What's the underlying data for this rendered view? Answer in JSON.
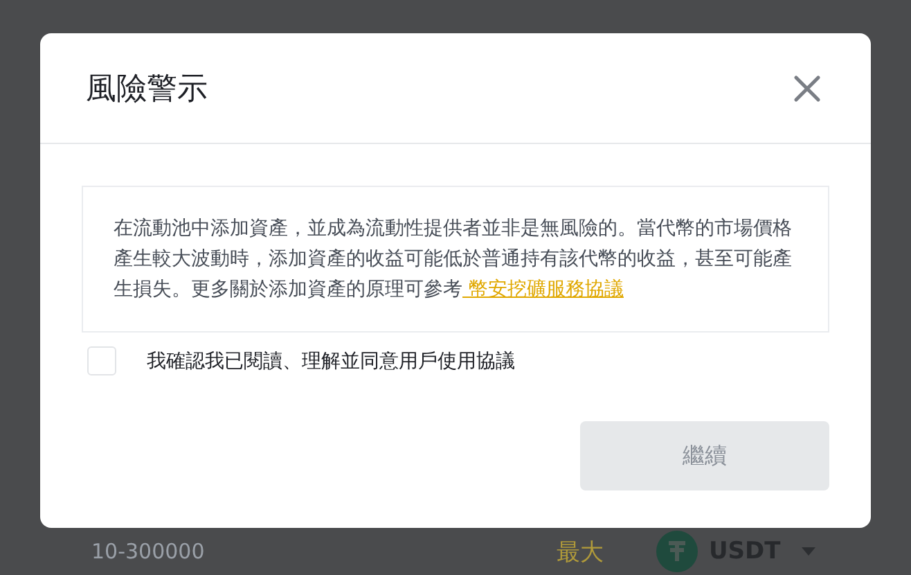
{
  "dialog": {
    "title": "風險警示",
    "notice": {
      "text": "在流動池中添加資產，並成為流動性提供者並非是無風險的。當代幣的市場價格產生較大波動時，添加資產的收益可能低於普通持有該代幣的收益，甚至可能產生損失。更多關於添加資產的原理可參考",
      "link": " 幣安挖礦服務協議"
    },
    "agreement": {
      "label": "我確認我已閱讀、理解並同意用戶使用協議",
      "checked": false
    },
    "continue_button": {
      "label": "繼續",
      "disabled": true
    }
  },
  "background_form": {
    "amount_placeholder": "10-300000",
    "max_label": "最大",
    "currency": "USDT"
  }
}
